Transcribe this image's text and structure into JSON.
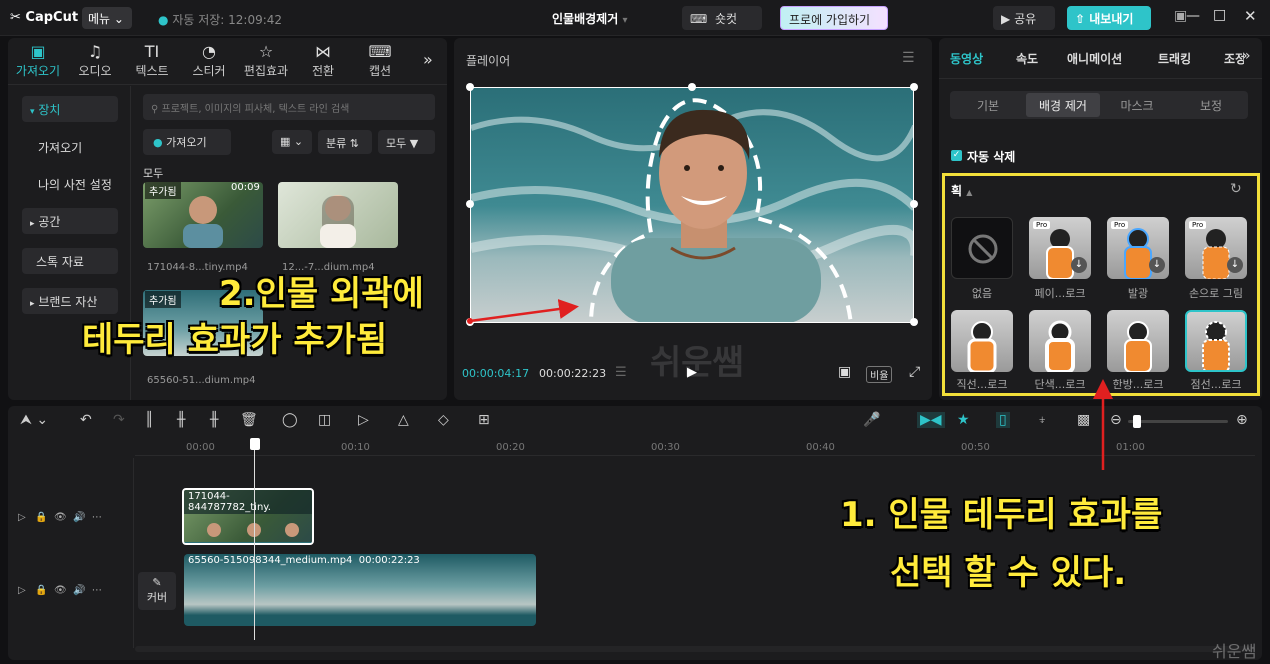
{
  "app": {
    "logo": "CapCut",
    "menu_label": "메뉴",
    "autosave": "자동 저장: 12:09:42",
    "project_title": "인물배경제거",
    "shortcut_label": "숏컷",
    "join_pro_label": "프로에 가입하기",
    "share_label": "공유",
    "export_label": "내보내기"
  },
  "media_tabs": [
    {
      "label": "가져오기",
      "icon": "import-icon"
    },
    {
      "label": "오디오",
      "icon": "audio-icon"
    },
    {
      "label": "텍스트",
      "icon": "text-icon"
    },
    {
      "label": "스티커",
      "icon": "sticker-icon"
    },
    {
      "label": "편집효과",
      "icon": "effects-icon"
    },
    {
      "label": "전환",
      "icon": "transition-icon"
    },
    {
      "label": "캡션",
      "icon": "caption-icon"
    }
  ],
  "sidebar": {
    "items": [
      "장치",
      "가져오기",
      "나의 사전 설정",
      "공간",
      "스톡 자료",
      "브랜드 자산"
    ]
  },
  "media": {
    "search_placeholder": "프로젝트, 이미지의 피사체, 텍스트 라인 검색",
    "import_button": "가져오기",
    "sort_label": "분류",
    "filter_label": "모두",
    "all_label": "모두",
    "clips": [
      {
        "badge": "추가됨",
        "duration": "00:09",
        "name": "171044-8...tiny.mp4"
      },
      {
        "badge": "",
        "duration": "",
        "name": "12...-7...dium.mp4"
      },
      {
        "badge": "추가됨",
        "duration": "",
        "name": "65560-51...dium.mp4"
      }
    ]
  },
  "player": {
    "title": "플레이어",
    "current_time": "00:00:04:17",
    "total_time": "00:00:22:23",
    "ratio_label": "비율"
  },
  "right_panel": {
    "tabs": [
      "동영상",
      "속도",
      "애니메이션",
      "트래킹",
      "조정"
    ],
    "subtabs": [
      "기본",
      "배경 제거",
      "마스크",
      "보정"
    ],
    "auto_remove_label": "자동 삭제",
    "stroke_section": "획",
    "effects": [
      "없음",
      "페이...로크",
      "발광",
      "손으로 그림",
      "직선...로크",
      "단색...로크",
      "한방...로크",
      "점선...로크"
    ],
    "pro_badge": "Pro"
  },
  "timeline": {
    "ticks": [
      "00:00",
      "00:10",
      "00:20",
      "00:30",
      "00:40",
      "00:50",
      "01:00"
    ],
    "clip1_name": "171044-844787782_tiny.",
    "clip2_name": "65560-515098344_medium.mp4",
    "clip2_duration": "00:00:22:23",
    "cover_label": "커버"
  },
  "annotations": {
    "callout2_line1": "2.인물 외곽에",
    "callout2_line2": "테두리 효과가 추가됨",
    "callout1_line1": "1. 인물 테두리 효과를",
    "callout1_line2": "선택 할 수 있다.",
    "watermark": "쉬운쌤",
    "watermark_center": "쉬운쌤"
  },
  "colors": {
    "accent": "#2ec4c9",
    "annotation": "#ffeb3b",
    "highlight_box": "#f2df3a",
    "arrow": "#e02020"
  }
}
